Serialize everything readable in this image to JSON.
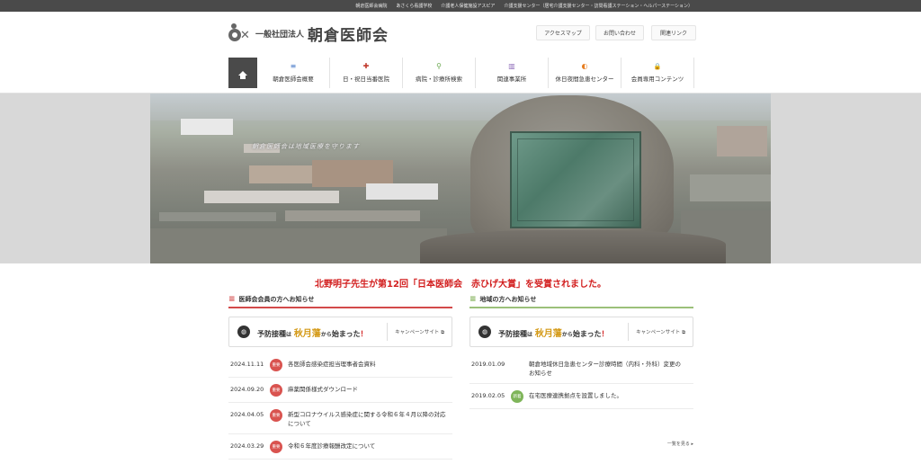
{
  "topbar": {
    "links": [
      "朝倉医師会病院",
      "|",
      "あさくら看護学校",
      "|",
      "介護老人保健施設アスピア",
      "|",
      "介護支援センター（居宅介護支援センター・訪問看護ステーション・ヘルパーステーション）"
    ]
  },
  "header": {
    "logo_prefix": "一般社団法人",
    "logo_name": "朝倉医師会",
    "util": [
      "アクセスマップ",
      "お問い合わせ",
      "関連リンク"
    ],
    "nav": [
      {
        "label": "朝倉医師会概要",
        "icon": "list-icon",
        "glyph": "≡",
        "color": "#4a7bc8"
      },
      {
        "label": "日・祝日当番医院",
        "icon": "cross-icon",
        "glyph": "✚",
        "color": "#c0392b"
      },
      {
        "label": "病院・診療所検索",
        "icon": "search-icon",
        "glyph": "⚲",
        "color": "#6aa84f"
      },
      {
        "label": "関連事業所",
        "icon": "building-icon",
        "glyph": "▥",
        "color": "#8e6bb8"
      },
      {
        "label": "休日夜間急患センター",
        "icon": "moon-icon",
        "glyph": "◐",
        "color": "#e67e22"
      },
      {
        "label": "会員専用コンテンツ",
        "icon": "lock-icon",
        "glyph": "🔒",
        "color": "#e0a800"
      }
    ]
  },
  "hero": {
    "caption": "朝倉医師会は地域医療を守ります"
  },
  "main": {
    "award": "北野明子先生が第12回「日本医師会　赤ひげ大賞」を受賞されました。",
    "members": {
      "title": "医師会会員の方へお知らせ",
      "banner": {
        "pre": "予防接種",
        "wa": "は",
        "em": "秋月藩",
        "kara": "から",
        "post": "始まった",
        "ex": "！",
        "site": "キャンペーンサイト"
      },
      "news": [
        {
          "date": "2024.11.11",
          "badge": "重要",
          "title": "各医師会感染症担当理事者会資料"
        },
        {
          "date": "2024.09.20",
          "badge": "重要",
          "title": "麻薬関係様式ダウンロード"
        },
        {
          "date": "2024.04.05",
          "badge": "重要",
          "title": "新型コロナウイルス感染症に関する令和６年４月以降の対応について"
        },
        {
          "date": "2024.03.29",
          "badge": "重要",
          "title": "令和６年度診療報酬改定について"
        }
      ]
    },
    "community": {
      "title": "地域の方へお知らせ",
      "banner": {
        "pre": "予防接種",
        "wa": "は",
        "em": "秋月藩",
        "kara": "から",
        "post": "始まった",
        "ex": "！",
        "site": "キャンペーンサイト"
      },
      "news": [
        {
          "date": "2019.01.09",
          "badge": "",
          "title": "朝倉地域休日急患センター診療時間（内科・外科）変更のお知らせ"
        },
        {
          "date": "2019.02.05",
          "badge": "新着",
          "title": "在宅医療連携拠点を設置しました。"
        }
      ],
      "more": "一覧を見る ▸"
    }
  }
}
